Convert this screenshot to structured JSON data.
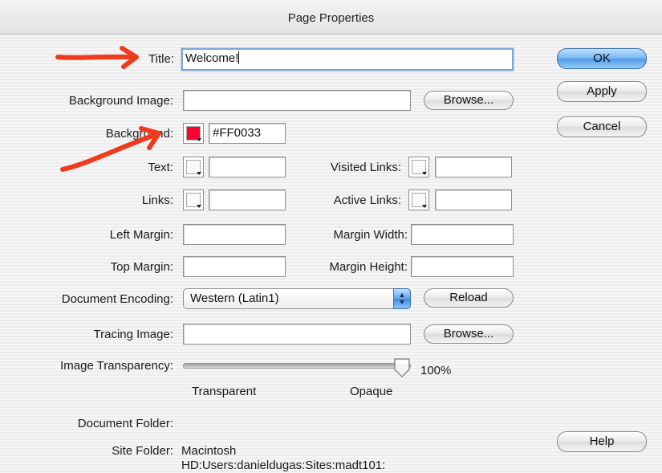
{
  "window": {
    "title": "Page Properties"
  },
  "fields": {
    "title_label": "Title:",
    "title_value": "Welcome!",
    "bg_image_label": "Background Image:",
    "bg_image_value": "",
    "background_label": "Background:",
    "background_hex": "#FF0033",
    "text_label": "Text:",
    "text_value": "",
    "visited_links_label": "Visited Links:",
    "visited_links_value": "",
    "links_label": "Links:",
    "links_value": "",
    "active_links_label": "Active Links:",
    "active_links_value": "",
    "left_margin_label": "Left Margin:",
    "left_margin_value": "",
    "margin_width_label": "Margin Width:",
    "margin_width_value": "",
    "top_margin_label": "Top Margin:",
    "top_margin_value": "",
    "margin_height_label": "Margin Height:",
    "margin_height_value": "",
    "encoding_label": "Document Encoding:",
    "encoding_value": "Western (Latin1)",
    "tracing_image_label": "Tracing Image:",
    "tracing_image_value": "",
    "transparency_label": "Image Transparency:",
    "transparency_value": "100%",
    "transparency_level": 1.0,
    "transparent_label": "Transparent",
    "opaque_label": "Opaque",
    "document_folder_label": "Document Folder:",
    "document_folder_value": "",
    "site_folder_label": "Site Folder:",
    "site_folder_line1": "Macintosh",
    "site_folder_line2": "HD:Users:danieldugas:Sites:madt101:"
  },
  "buttons": {
    "ok": "OK",
    "apply": "Apply",
    "cancel": "Cancel",
    "help": "Help",
    "browse": "Browse...",
    "reload": "Reload"
  },
  "colors": {
    "background_swatch": "#FF0033",
    "annotation_arrow": "#F03A1E",
    "default_button": "#5EA3EA"
  },
  "icons": {
    "color_picker": "color-swatch-dropdown",
    "select_stepper": "up-down-arrows",
    "slider_thumb": "slider-thumb",
    "annotation": "red-hand-drawn-arrow"
  }
}
